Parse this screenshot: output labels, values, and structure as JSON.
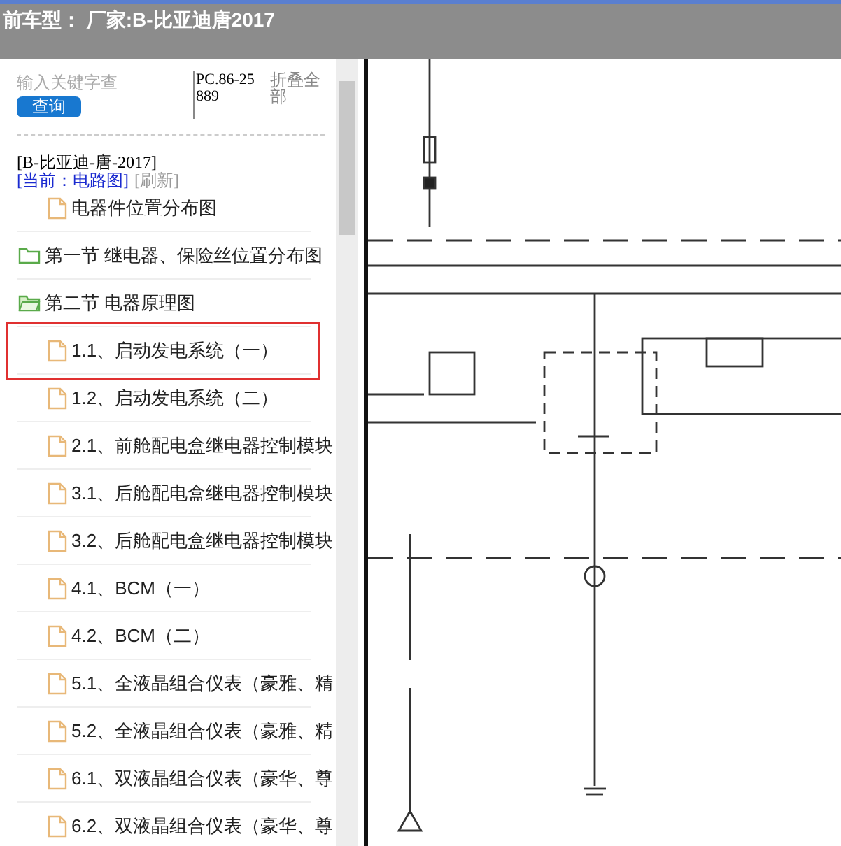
{
  "header": {
    "title": "前车型： 厂家:B-比亚迪唐2017"
  },
  "search": {
    "placeholder": "输入关键字查",
    "button": "查询",
    "phone": "PC.86-25889",
    "collapse_all": "折叠全部"
  },
  "tree_header": {
    "model": "[B-比亚迪-唐-2017]",
    "current": "[当前：电路图]",
    "refresh": "[刷新]"
  },
  "tree": [
    {
      "kind": "file",
      "label": "电器件位置分布图",
      "selected": false
    },
    {
      "kind": "folder",
      "label": "第一节 继电器、保险丝位置分布图",
      "expanded": false,
      "selected": false
    },
    {
      "kind": "folder",
      "label": "第二节 电器原理图",
      "expanded": true,
      "selected": false,
      "children": [
        {
          "kind": "file",
          "label": "1.1、启动发电系统（一）",
          "selected": true
        },
        {
          "kind": "file",
          "label": "1.2、启动发电系统（二）",
          "selected": false
        },
        {
          "kind": "file",
          "label": "2.1、前舱配电盒继电器控制模块",
          "selected": false
        },
        {
          "kind": "file",
          "label": "3.1、后舱配电盒继电器控制模块",
          "selected": false
        },
        {
          "kind": "file",
          "label": "3.2、后舱配电盒继电器控制模块",
          "selected": false
        },
        {
          "kind": "file",
          "label": "4.1、BCM（一）",
          "selected": false
        },
        {
          "kind": "file",
          "label": "4.2、BCM（二）",
          "selected": false
        },
        {
          "kind": "file",
          "label": "5.1、全液晶组合仪表（豪雅、精",
          "selected": false
        },
        {
          "kind": "file",
          "label": "5.2、全液晶组合仪表（豪雅、精",
          "selected": false
        },
        {
          "kind": "file",
          "label": "6.1、双液晶组合仪表（豪华、尊",
          "selected": false
        },
        {
          "kind": "file",
          "label": "6.2、双液晶组合仪表（豪华、尊",
          "selected": false
        }
      ]
    }
  ]
}
